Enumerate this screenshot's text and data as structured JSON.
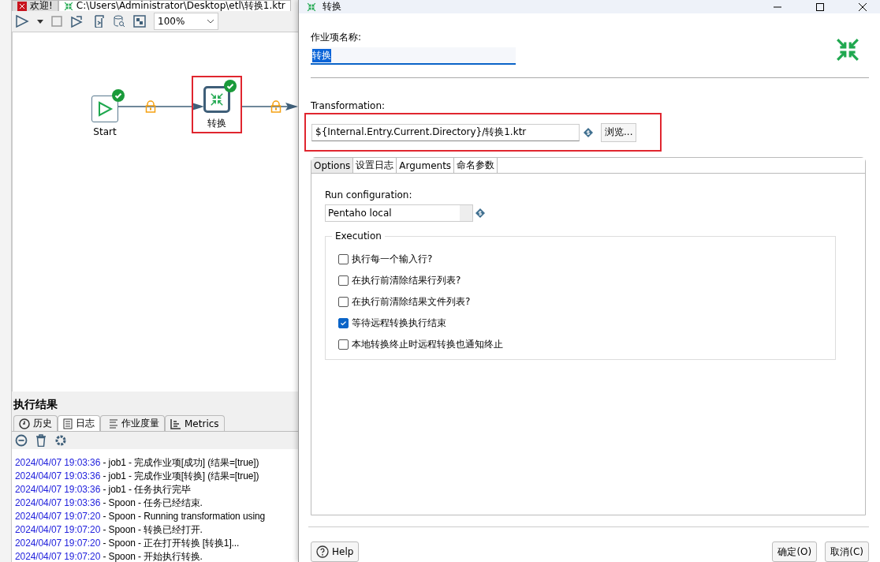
{
  "editor_tabs": [
    {
      "label": "欢迎!",
      "kind": "welcome",
      "selected": false
    },
    {
      "label": "C:\\Users\\Administrator\\Desktop\\etl\\转换1.ktr",
      "kind": "transform",
      "selected": true
    }
  ],
  "toolbar": {
    "zoom": "100%"
  },
  "canvas": {
    "nodes": [
      {
        "label": "Start",
        "kind": "start",
        "highlighted": false
      },
      {
        "label": "转换",
        "kind": "transform",
        "highlighted": true
      }
    ]
  },
  "results": {
    "title": "执行结果",
    "tabs": [
      {
        "label": "历史",
        "kind": "history",
        "selected": false
      },
      {
        "label": "日志",
        "kind": "log",
        "selected": true
      },
      {
        "label": "作业度量",
        "kind": "metrics-list",
        "selected": false
      },
      {
        "label": "Metrics",
        "kind": "metrics",
        "selected": false
      }
    ],
    "log": [
      {
        "time": "2024/04/07 19:03:36",
        "message": " - job1 - 完成作业项[成功] (结果=[true])"
      },
      {
        "time": "2024/04/07 19:03:36",
        "message": " - job1 - 完成作业项[转换] (结果=[true])"
      },
      {
        "time": "2024/04/07 19:03:36",
        "message": " - job1 - 任务执行完毕"
      },
      {
        "time": "2024/04/07 19:03:36",
        "message": " - Spoon - 任务已经结束."
      },
      {
        "time": "2024/04/07 19:07:20",
        "message": " - Spoon - Running transformation using"
      },
      {
        "time": "2024/04/07 19:07:20",
        "message": " - Spoon - 转换已经打开."
      },
      {
        "time": "2024/04/07 19:07:20",
        "message": " - Spoon - 正在打开转换 [转换1]..."
      },
      {
        "time": "2024/04/07 19:07:20",
        "message": " - Spoon - 开始执行转换."
      }
    ]
  },
  "dialog": {
    "title": "转换",
    "name_label": "作业项名称:",
    "name_value": "转换",
    "transformation_label": "Transformation:",
    "transformation_value": "${Internal.Entry.Current.Directory}/转换1.ktr",
    "browse": "浏览...",
    "tabs": [
      {
        "label": "Options",
        "selected": true
      },
      {
        "label": "设置日志",
        "selected": false
      },
      {
        "label": "Arguments",
        "selected": false
      },
      {
        "label": "命名参数",
        "selected": false
      }
    ],
    "run_config_label": "Run configuration:",
    "run_config_value": "Pentaho local",
    "group_title": "Execution",
    "options": [
      {
        "label": "执行每一个输入行?",
        "checked": false
      },
      {
        "label": "在执行前清除结果行列表?",
        "checked": false
      },
      {
        "label": "在执行前清除结果文件列表?",
        "checked": false
      },
      {
        "label": "等待远程转换执行结束",
        "checked": true
      },
      {
        "label": "本地转换终止时远程转换也通知终止",
        "checked": false
      }
    ],
    "help": "Help",
    "ok": "确定(O)",
    "cancel": "取消(C)"
  }
}
